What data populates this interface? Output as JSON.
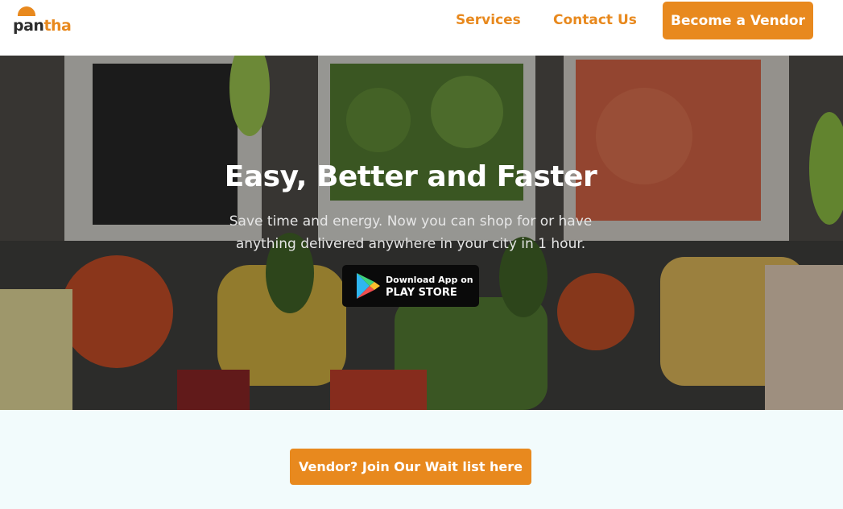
{
  "brand": {
    "logo_pan": "pan",
    "logo_tha": "tha",
    "accent_color": "#e8891e"
  },
  "nav": {
    "services": "Services",
    "contact": "Contact Us",
    "become_vendor": "Become a Vendor"
  },
  "hero": {
    "title": "Easy, Better and Faster",
    "subtitle": "Save time and energy. Now you can shop for or have anything delivered anywhere in your city in 1 hour.",
    "play_store": {
      "line1": "Download App on",
      "line2": "PLAY STORE",
      "icon": "google-play-icon"
    }
  },
  "waitlist": {
    "label": "Vendor? Join Our Wait list here"
  }
}
